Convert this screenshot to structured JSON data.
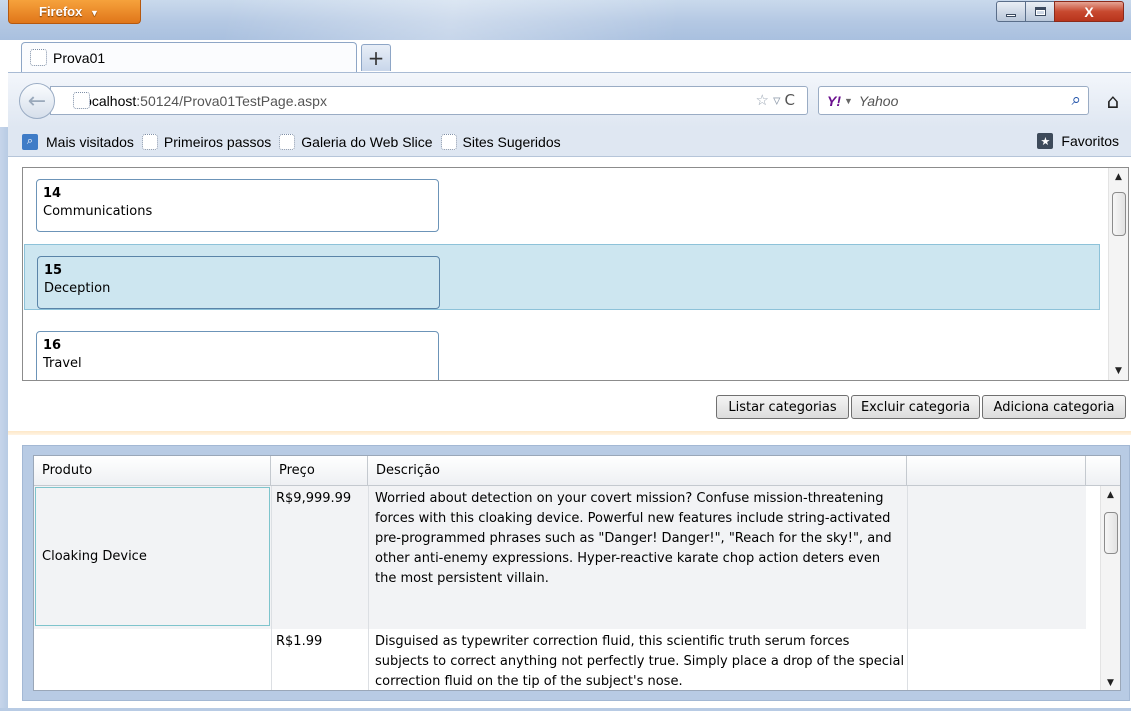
{
  "window": {
    "menu_label": "Firefox",
    "menu_arrow": "▼",
    "close_glyph": "X"
  },
  "tabs": {
    "active_label": "Prova01",
    "new_tab_glyph": "+"
  },
  "navbar": {
    "url_host": "localhost",
    "url_rest": ":50124/Prova01TestPage.aspx",
    "search_logo": "Y!",
    "search_placeholder": "Yahoo"
  },
  "bookmarks": {
    "items": [
      "Mais visitados",
      "Primeiros passos",
      "Galeria do Web Slice",
      "Sites Sugeridos"
    ],
    "favorites_label": "Favoritos"
  },
  "categories": {
    "items": [
      {
        "id": "14",
        "name": "Communications",
        "selected": false
      },
      {
        "id": "15",
        "name": "Deception",
        "selected": true
      },
      {
        "id": "16",
        "name": "Travel",
        "selected": false
      }
    ]
  },
  "actions": {
    "list_label": "Listar categorias",
    "delete_label": "Excluir categoria",
    "add_label": "Adiciona categoria"
  },
  "products": {
    "columns": [
      "Produto",
      "Preço",
      "Descrição",
      ""
    ],
    "rows": [
      {
        "product": "Cloaking Device",
        "price": "R$9,999.99",
        "description": "Worried about detection on your covert mission? Confuse mission-threatening forces with this cloaking device. Powerful new features include string-activated pre-programmed phrases such as \"Danger! Danger!\", \"Reach for the sky!\", and other anti-enemy expressions. Hyper-reactive karate chop action deters even the most persistent villain."
      },
      {
        "product": "",
        "price": "R$1.99",
        "description": "Disguised as typewriter correction fluid, this scientific truth serum forces subjects to correct anything not perfectly true. Simply place a drop of the special correction fluid on the tip of the subject's nose."
      }
    ]
  }
}
